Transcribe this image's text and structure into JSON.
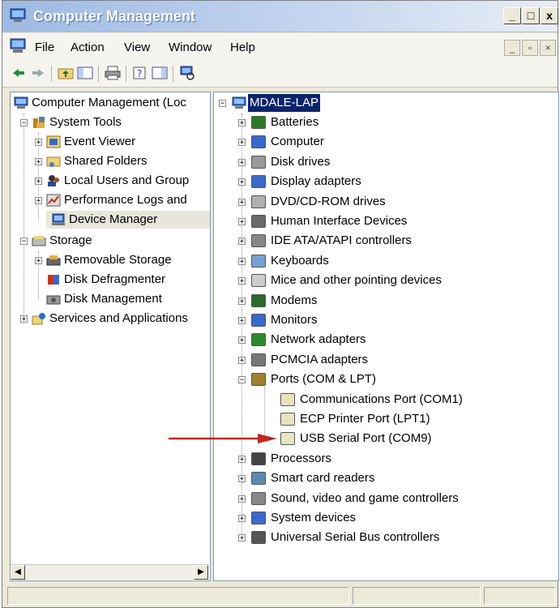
{
  "window": {
    "title": "Computer Management",
    "controls": {
      "minimize": "_",
      "maximize": "□",
      "close": "x"
    }
  },
  "menubar": {
    "items": [
      "File",
      "Action",
      "View",
      "Window",
      "Help"
    ]
  },
  "left_tree": {
    "root": "Computer Management (Loc",
    "system_tools": "System Tools",
    "system_tools_children": [
      "Event Viewer",
      "Shared Folders",
      "Local Users and Group",
      "Performance Logs and",
      "Device Manager"
    ],
    "storage": "Storage",
    "storage_children": [
      "Removable Storage",
      "Disk Defragmenter",
      "Disk Management"
    ],
    "services": "Services and Applications",
    "selected": "Device Manager"
  },
  "right_tree": {
    "root": "MDALE-LAP",
    "categories": [
      "Batteries",
      "Computer",
      "Disk drives",
      "Display adapters",
      "DVD/CD-ROM drives",
      "Human Interface Devices",
      "IDE ATA/ATAPI controllers",
      "Keyboards",
      "Mice and other pointing devices",
      "Modems",
      "Monitors",
      "Network adapters",
      "PCMCIA adapters",
      "Ports (COM & LPT)"
    ],
    "ports_children": [
      "Communications Port (COM1)",
      "ECP Printer Port (LPT1)",
      "USB Serial Port (COM9)"
    ],
    "after_ports": [
      "Processors",
      "Smart card readers",
      "Sound, video and game controllers",
      "System devices",
      "Universal Serial Bus controllers"
    ]
  },
  "colors": {
    "arrow": "#c0281f",
    "selection": "#0a246a"
  }
}
